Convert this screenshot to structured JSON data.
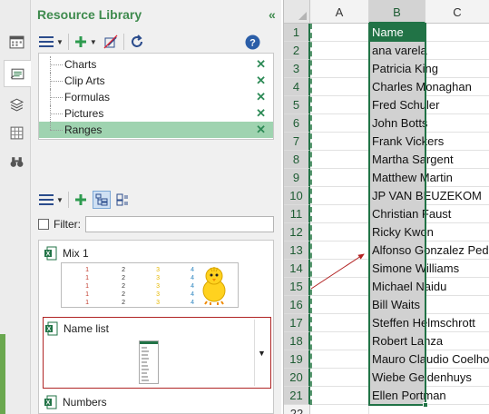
{
  "pane": {
    "title": "Resource Library",
    "collapse_icon": "double-chevron-left-icon",
    "toolbar_icons": [
      "menu-icon",
      "add-icon",
      "edit-icon",
      "refresh-icon",
      "help-icon"
    ],
    "categories": [
      {
        "label": "Charts"
      },
      {
        "label": "Clip Arts"
      },
      {
        "label": "Formulas"
      },
      {
        "label": "Pictures"
      },
      {
        "label": "Ranges",
        "selected": true
      }
    ],
    "filter_label": "Filter:",
    "filter_value": "",
    "items": [
      {
        "name": "Mix 1"
      },
      {
        "name": "Name list",
        "selected": true
      },
      {
        "name": "Numbers"
      }
    ],
    "mix_thumb": {
      "cols": [
        {
          "color": "#c0392b",
          "values": [
            "1",
            "1",
            "1",
            "1",
            "1"
          ]
        },
        {
          "color": "#333333",
          "values": [
            "2",
            "2",
            "2",
            "2",
            "2"
          ]
        },
        {
          "color": "#e6b800",
          "values": [
            "3",
            "3",
            "3",
            "3",
            "3"
          ]
        },
        {
          "color": "#2e86c1",
          "values": [
            "4",
            "4",
            "4",
            "4",
            "4"
          ]
        }
      ]
    }
  },
  "sidebar_icons": [
    "calendar-icon",
    "resource-library-icon",
    "layers-icon",
    "grid-icon",
    "binoculars-icon"
  ],
  "sheet": {
    "columns": [
      "A",
      "B",
      "C"
    ],
    "selected_column": "B",
    "rows": [
      "1",
      "2",
      "3",
      "4",
      "5",
      "6",
      "7",
      "8",
      "9",
      "10",
      "11",
      "12",
      "13",
      "14",
      "15",
      "16",
      "17",
      "18",
      "19",
      "20",
      "21",
      "22"
    ],
    "column_b": [
      "Name",
      "ana varela",
      "Patricia King",
      "Charles Monaghan",
      "Fred Schuler",
      "John Botts",
      "Frank Vickers",
      "Martha Sargent",
      "Matthew Martin",
      "JP VAN BEUZEKOM",
      "Christian Faust",
      "Ricky Kwon",
      "Alfonso Gonzalez Pedroza",
      "Simone Williams",
      "Michael Naidu",
      "Bill Waits",
      "Steffen Helmschrott",
      "Robert Lanza",
      "Mauro Claudio Coelho",
      "Wiebe Geldenhuys",
      "Ellen Portman"
    ],
    "header_fill": "#217346",
    "selection_color": "#217346"
  }
}
